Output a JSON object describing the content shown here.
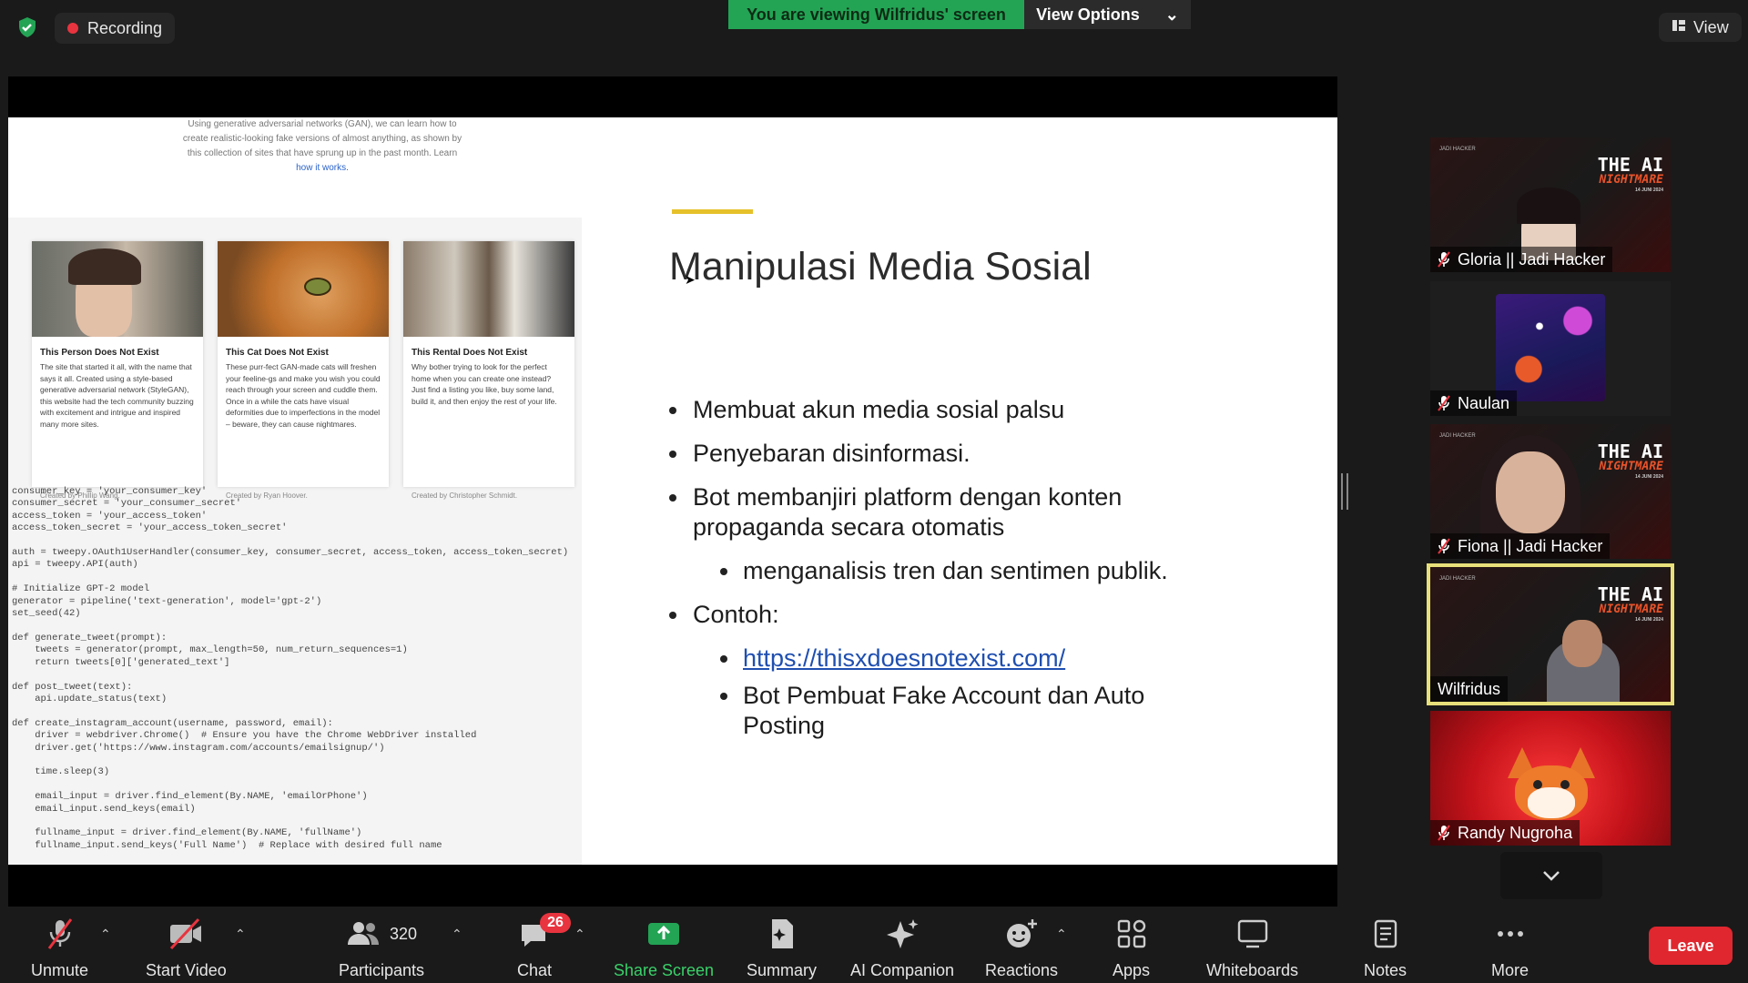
{
  "top": {
    "recording_label": "Recording",
    "viewing_banner": "You are viewing Wilfridus' screen",
    "view_options_label": "View Options",
    "view_label": "View"
  },
  "slide": {
    "intro_lines": [
      "Using generative adversarial networks (GAN), we can learn how to",
      "create realistic-looking fake versions of almost anything, as shown by",
      "this collection of sites that have sprung up in the past month. Learn"
    ],
    "intro_link": "how it works.",
    "cards": [
      {
        "title": "This Person Does Not Exist",
        "desc": "The site that started it all, with the name that says it all. Created using a style-based generative adversarial network (StyleGAN), this website had the tech community buzzing with excitement and intrigue and inspired many more sites.",
        "footer": "Created by Phillip Wang."
      },
      {
        "title": "This Cat Does Not Exist",
        "desc": "These purr-fect GAN-made cats will freshen your feeline-gs and make you wish you could reach through your screen and cuddle them. Once in a while the cats have visual deformities due to imperfections in the model – beware, they can cause nightmares.",
        "footer": "Created by Ryan Hoover."
      },
      {
        "title": "This Rental Does Not Exist",
        "desc": "Why bother trying to look for the perfect home when you can create one instead? Just find a listing you like, buy some land, build it, and then enjoy the rest of your life.",
        "footer": "Created by Christopher Schmidt."
      }
    ],
    "code": "consumer_key = 'your_consumer_key'\nconsumer_secret = 'your_consumer_secret'\naccess_token = 'your_access_token'\naccess_token_secret = 'your_access_token_secret'\n\nauth = tweepy.OAuth1UserHandler(consumer_key, consumer_secret, access_token, access_token_secret)\napi = tweepy.API(auth)\n\n# Initialize GPT-2 model\ngenerator = pipeline('text-generation', model='gpt-2')\nset_seed(42)\n\ndef generate_tweet(prompt):\n    tweets = generator(prompt, max_length=50, num_return_sequences=1)\n    return tweets[0]['generated_text']\n\ndef post_tweet(text):\n    api.update_status(text)\n\ndef create_instagram_account(username, password, email):\n    driver = webdriver.Chrome()  # Ensure you have the Chrome WebDriver installed\n    driver.get('https://www.instagram.com/accounts/emailsignup/')\n\n    time.sleep(3)\n\n    email_input = driver.find_element(By.NAME, 'emailOrPhone')\n    email_input.send_keys(email)\n\n    fullname_input = driver.find_element(By.NAME, 'fullName')\n    fullname_input.send_keys('Full Name')  # Replace with desired full name",
    "title": "Manipulasi Media Sosial",
    "bullets": {
      "b1": "Membuat akun media sosial palsu",
      "b2": "Penyebaran disinformasi.",
      "b3": "Bot membanjiri platform dengan konten propaganda secara otomatis",
      "b3_sub": "menganalisis tren dan sentimen publik.",
      "b4": "Contoh:",
      "b4_link": "https://thisxdoesnotexist.com/",
      "b4_sub2": "Bot Pembuat Fake Account dan Auto Posting"
    }
  },
  "participants": [
    {
      "name": "Gloria || Jadi Hacker",
      "muted": true
    },
    {
      "name": "Naulan",
      "muted": true
    },
    {
      "name": "Fiona || Jadi Hacker",
      "muted": true
    },
    {
      "name": "Wilfridus",
      "muted": false,
      "active_speaker": true
    },
    {
      "name": "Randy Nugroha",
      "muted": true
    }
  ],
  "tile_overlay": {
    "line1": "THE AI",
    "line2": "NIGHTMARE",
    "date": "14 JUNI 2024",
    "brand": "JADI HACKER"
  },
  "toolbar": {
    "unmute": "Unmute",
    "start_video": "Start Video",
    "participants": "Participants",
    "participants_count": "320",
    "chat": "Chat",
    "chat_badge": "26",
    "share_screen": "Share Screen",
    "summary": "Summary",
    "ai_companion": "AI Companion",
    "reactions": "Reactions",
    "apps": "Apps",
    "whiteboards": "Whiteboards",
    "notes": "Notes",
    "more": "More",
    "leave": "Leave"
  },
  "colors": {
    "share_green": "#23a455",
    "leave_red": "#e0272f",
    "speaker_border": "#e8e07a",
    "accent_yellow": "#e6c12a"
  }
}
